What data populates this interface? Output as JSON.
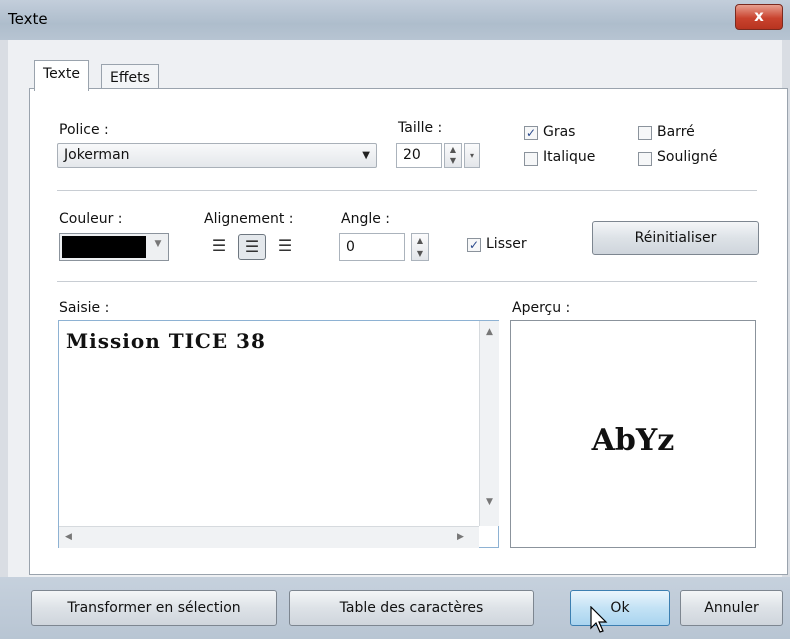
{
  "window": {
    "title": "Texte",
    "close_label": "x"
  },
  "tabs": [
    {
      "label": "Texte"
    },
    {
      "label": "Effets"
    }
  ],
  "font": {
    "label": "Police :",
    "value": "Jokerman"
  },
  "size": {
    "label": "Taille :",
    "value": "20"
  },
  "styles": {
    "bold": {
      "label": "Gras",
      "checked": true
    },
    "italic": {
      "label": "Italique",
      "checked": false
    },
    "strike": {
      "label": "Barré",
      "checked": false
    },
    "underline": {
      "label": "Souligné",
      "checked": false
    }
  },
  "color": {
    "label": "Couleur :",
    "value": "#000000"
  },
  "alignment": {
    "label": "Alignement :",
    "options": [
      "left",
      "center",
      "right"
    ],
    "selected": "center"
  },
  "angle": {
    "label": "Angle :",
    "value": "0"
  },
  "smooth": {
    "label": "Lisser",
    "checked": true
  },
  "reset_label": "Réinitialiser",
  "input": {
    "label": "Saisie :",
    "text": "Mission TICE 38"
  },
  "preview": {
    "label": "Aperçu :",
    "sample": "AbYz"
  },
  "footer": {
    "to_selection": "Transformer en sélection",
    "char_table": "Table des caractères",
    "ok": "Ok",
    "cancel": "Annuler"
  },
  "check_mark": "✓"
}
